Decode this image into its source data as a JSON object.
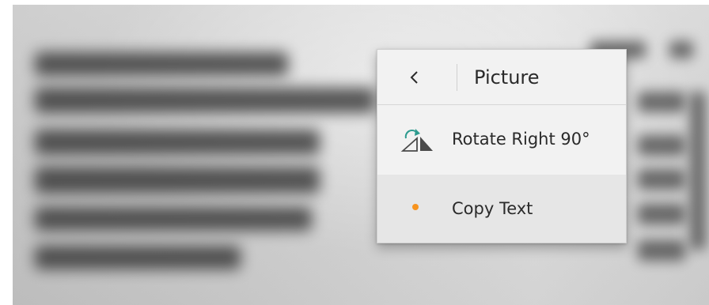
{
  "menu": {
    "title": "Picture",
    "back_icon": "chevron-left-icon",
    "items": [
      {
        "label": "Rotate Right 90°",
        "icon": "rotate-right-icon"
      },
      {
        "label": "Copy Text",
        "icon": "bullet-dot-icon"
      }
    ]
  },
  "colors": {
    "menu_background": "#f2f2f2",
    "hover_background": "#e6e6e6",
    "rotate_icon_accent": "#2e9b8f",
    "dot_accent": "#f7931e",
    "text": "#2a2a2a"
  }
}
